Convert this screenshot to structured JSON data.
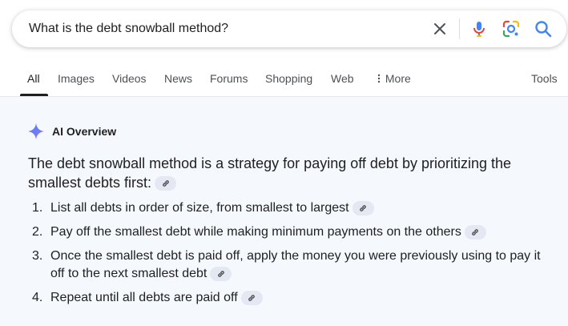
{
  "search": {
    "query": "What is the debt snowball method?",
    "clear_icon": "close-icon",
    "mic_icon": "microphone-icon",
    "lens_icon": "camera-lens-icon",
    "search_icon": "magnifier-icon"
  },
  "tabs": [
    {
      "label": "All",
      "active": true
    },
    {
      "label": "Images"
    },
    {
      "label": "Videos"
    },
    {
      "label": "News"
    },
    {
      "label": "Forums"
    },
    {
      "label": "Shopping"
    },
    {
      "label": "Web"
    },
    {
      "label": "More",
      "icon": "vertical-dots-icon"
    }
  ],
  "tools_label": "Tools",
  "ai_overview": {
    "title": "AI Overview",
    "icon": "sparkle-icon",
    "summary": "The debt snowball method is a strategy for paying off debt by prioritizing the smallest debts first:",
    "link_icon": "link-icon",
    "steps": [
      {
        "num": "1.",
        "text": "List all debts in order of size, from smallest to largest"
      },
      {
        "num": "2.",
        "text": "Pay off the smallest debt while making minimum payments on the others"
      },
      {
        "num": "3.",
        "text": "Once the smallest debt is paid off, apply the money you were previously using to pay it off to the next smallest debt"
      },
      {
        "num": "4.",
        "text": "Repeat until all debts are paid off"
      }
    ]
  },
  "colors": {
    "accent_blue": "#4285f4",
    "text_primary": "#1f1f1f",
    "text_secondary": "#4d5156",
    "overview_bg": "#f5f8fd",
    "chip_bg": "#e3e8f3"
  }
}
